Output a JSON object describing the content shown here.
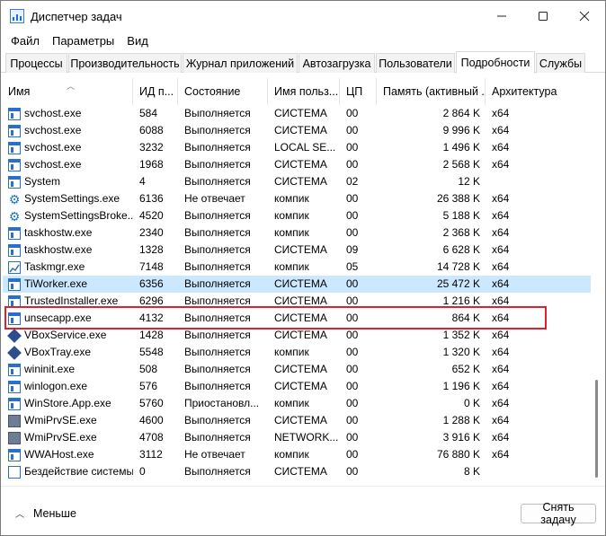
{
  "window": {
    "title": "Диспетчер задач",
    "minimize_icon": "minimize-icon",
    "maximize_icon": "maximize-icon",
    "close_icon": "close-icon"
  },
  "menu": [
    "Файл",
    "Параметры",
    "Вид"
  ],
  "tabs": [
    {
      "label": "Процессы",
      "active": false
    },
    {
      "label": "Производительность",
      "active": false
    },
    {
      "label": "Журнал приложений",
      "active": false
    },
    {
      "label": "Автозагрузка",
      "active": false
    },
    {
      "label": "Пользователи",
      "active": false
    },
    {
      "label": "Подробности",
      "active": true
    },
    {
      "label": "Службы",
      "active": false
    }
  ],
  "columns": [
    "Имя",
    "ИД п...",
    "Состояние",
    "Имя польз...",
    "ЦП",
    "Память (активный ...",
    "Архитектура"
  ],
  "rows": [
    {
      "icon": "generic",
      "name": "svchost.exe",
      "pid": "584",
      "status": "Выполняется",
      "user": "СИСТЕМА",
      "cpu": "00",
      "mem": "2 864 K",
      "arch": "x64"
    },
    {
      "icon": "generic",
      "name": "svchost.exe",
      "pid": "6088",
      "status": "Выполняется",
      "user": "СИСТЕМА",
      "cpu": "00",
      "mem": "9 996 K",
      "arch": "x64"
    },
    {
      "icon": "generic",
      "name": "svchost.exe",
      "pid": "3232",
      "status": "Выполняется",
      "user": "LOCAL SE...",
      "cpu": "00",
      "mem": "1 496 K",
      "arch": "x64"
    },
    {
      "icon": "generic",
      "name": "svchost.exe",
      "pid": "1968",
      "status": "Выполняется",
      "user": "СИСТЕМА",
      "cpu": "00",
      "mem": "2 568 K",
      "arch": "x64"
    },
    {
      "icon": "generic",
      "name": "System",
      "pid": "4",
      "status": "Выполняется",
      "user": "СИСТЕМА",
      "cpu": "02",
      "mem": "12 K",
      "arch": ""
    },
    {
      "icon": "gear",
      "name": "SystemSettings.exe",
      "pid": "6136",
      "status": "Не отвечает",
      "user": "компик",
      "cpu": "00",
      "mem": "26 388 K",
      "arch": "x64"
    },
    {
      "icon": "gear",
      "name": "SystemSettingsBroke...",
      "pid": "4520",
      "status": "Выполняется",
      "user": "компик",
      "cpu": "00",
      "mem": "5 188 K",
      "arch": "x64"
    },
    {
      "icon": "generic",
      "name": "taskhostw.exe",
      "pid": "2340",
      "status": "Выполняется",
      "user": "компик",
      "cpu": "00",
      "mem": "2 368 K",
      "arch": "x64"
    },
    {
      "icon": "generic",
      "name": "taskhostw.exe",
      "pid": "1328",
      "status": "Выполняется",
      "user": "СИСТЕМА",
      "cpu": "09",
      "mem": "6 628 K",
      "arch": "x64"
    },
    {
      "icon": "chart",
      "name": "Taskmgr.exe",
      "pid": "7148",
      "status": "Выполняется",
      "user": "компик",
      "cpu": "05",
      "mem": "14 728 K",
      "arch": "x64"
    },
    {
      "icon": "generic",
      "name": "TiWorker.exe",
      "pid": "6356",
      "status": "Выполняется",
      "user": "СИСТЕМА",
      "cpu": "00",
      "mem": "25 472 K",
      "arch": "x64",
      "selected": true
    },
    {
      "icon": "generic",
      "name": "TrustedInstaller.exe",
      "pid": "6296",
      "status": "Выполняется",
      "user": "СИСТЕМА",
      "cpu": "00",
      "mem": "1 216 K",
      "arch": "x64"
    },
    {
      "icon": "generic",
      "name": "unsecapp.exe",
      "pid": "4132",
      "status": "Выполняется",
      "user": "СИСТЕМА",
      "cpu": "00",
      "mem": "864 K",
      "arch": "x64"
    },
    {
      "icon": "vbox",
      "name": "VBoxService.exe",
      "pid": "1428",
      "status": "Выполняется",
      "user": "СИСТЕМА",
      "cpu": "00",
      "mem": "1 352 K",
      "arch": "x64"
    },
    {
      "icon": "vbox",
      "name": "VBoxTray.exe",
      "pid": "5548",
      "status": "Выполняется",
      "user": "компик",
      "cpu": "00",
      "mem": "1 320 K",
      "arch": "x64"
    },
    {
      "icon": "generic",
      "name": "wininit.exe",
      "pid": "508",
      "status": "Выполняется",
      "user": "СИСТЕМА",
      "cpu": "00",
      "mem": "652 K",
      "arch": "x64"
    },
    {
      "icon": "generic",
      "name": "winlogon.exe",
      "pid": "576",
      "status": "Выполняется",
      "user": "СИСТЕМА",
      "cpu": "00",
      "mem": "1 196 K",
      "arch": "x64"
    },
    {
      "icon": "generic",
      "name": "WinStore.App.exe",
      "pid": "5760",
      "status": "Приостановл...",
      "user": "компик",
      "cpu": "00",
      "mem": "0 K",
      "arch": "x64"
    },
    {
      "icon": "wmi",
      "name": "WmiPrvSE.exe",
      "pid": "4600",
      "status": "Выполняется",
      "user": "СИСТЕМА",
      "cpu": "00",
      "mem": "1 288 K",
      "arch": "x64"
    },
    {
      "icon": "wmi",
      "name": "WmiPrvSE.exe",
      "pid": "4708",
      "status": "Выполняется",
      "user": "NETWORK...",
      "cpu": "00",
      "mem": "3 916 K",
      "arch": "x64"
    },
    {
      "icon": "generic",
      "name": "WWAHost.exe",
      "pid": "3112",
      "status": "Не отвечает",
      "user": "компик",
      "cpu": "00",
      "mem": "76 880 K",
      "arch": "x64"
    },
    {
      "icon": "idle",
      "name": "Бездействие системы",
      "pid": "0",
      "status": "Выполняется",
      "user": "СИСТЕМА",
      "cpu": "00",
      "mem": "8 K",
      "arch": ""
    }
  ],
  "footer": {
    "fewer_label": "Меньше",
    "end_task_label": "Снять задачу"
  }
}
